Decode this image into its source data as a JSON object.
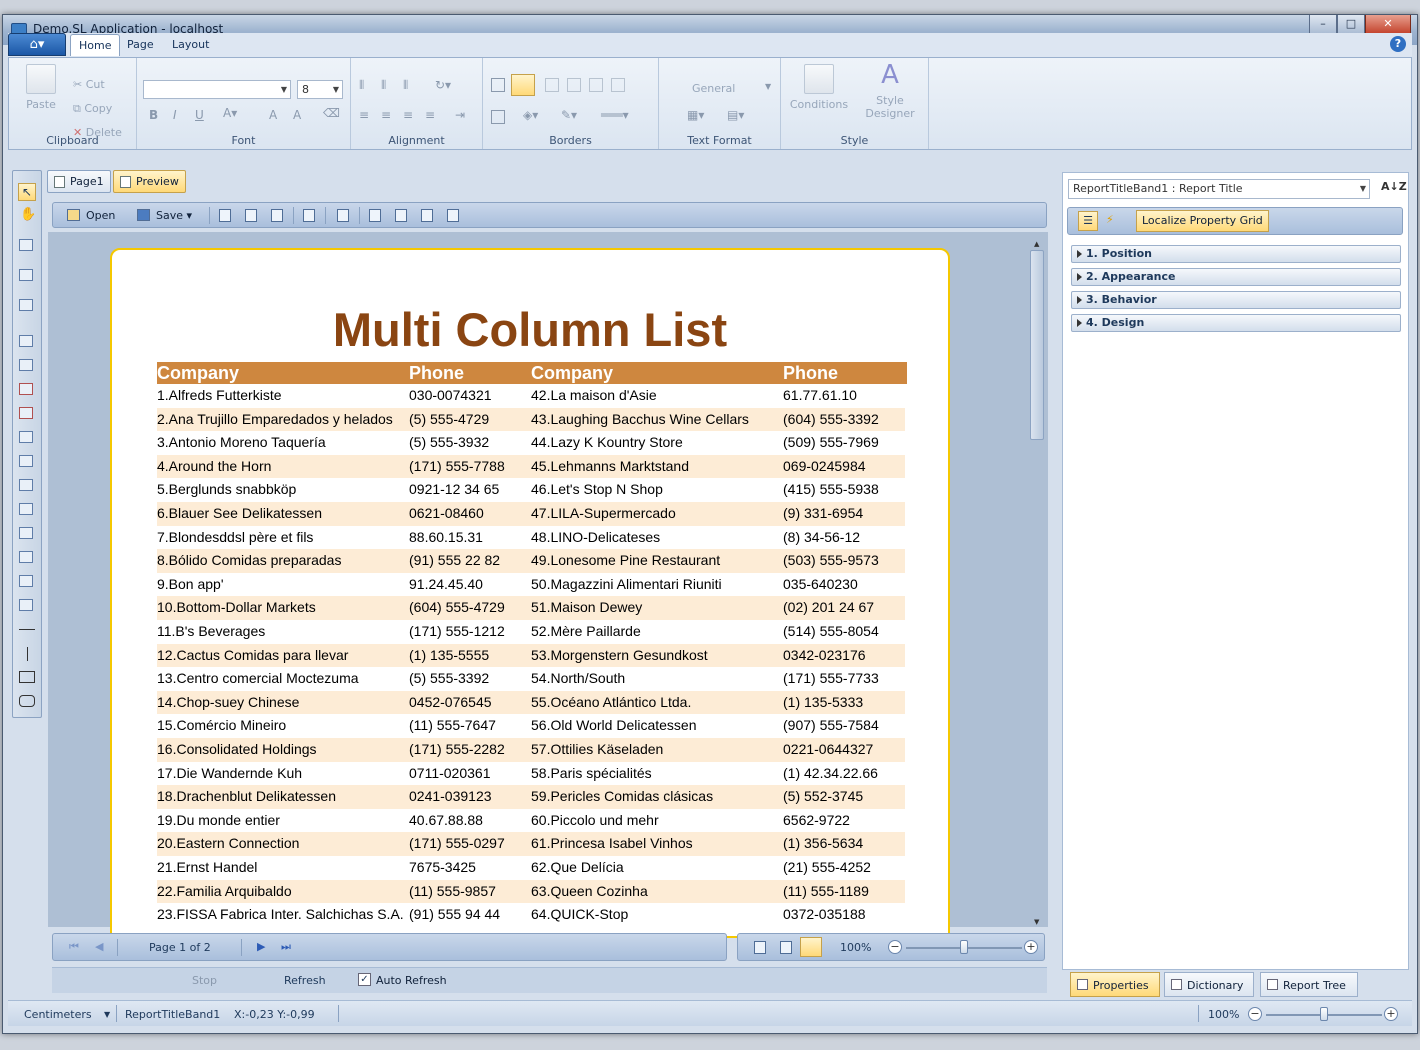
{
  "window": {
    "title": "Demo.SL Application - localhost",
    "minimize": "–",
    "maximize": "□",
    "close": "✕"
  },
  "ribbon": {
    "tabs": [
      "Home",
      "Page",
      "Layout"
    ],
    "active_tab": "Home",
    "help": "?",
    "clipboard": {
      "label": "Clipboard",
      "paste": "Paste",
      "cut": "Cut",
      "copy": "Copy",
      "delete": "Delete"
    },
    "font": {
      "label": "Font",
      "family": "",
      "size": "8"
    },
    "alignment": {
      "label": "Alignment"
    },
    "borders": {
      "label": "Borders"
    },
    "text_format": {
      "label": "Text Format",
      "format": "General"
    },
    "style": {
      "label": "Style",
      "conditions": "Conditions",
      "style_designer_1": "Style",
      "style_designer_2": "Designer"
    }
  },
  "doc_tabs": [
    "Page1",
    "Preview"
  ],
  "preview_toolbar": {
    "open": "Open",
    "save": "Save"
  },
  "report": {
    "title": "Multi Column List",
    "headers": [
      "Company",
      "Phone",
      "Company",
      "Phone"
    ],
    "rows": [
      [
        "1.Alfreds Futterkiste",
        "030-0074321",
        "42.La maison d'Asie",
        "61.77.61.10"
      ],
      [
        "2.Ana Trujillo Emparedados y helados",
        "(5) 555-4729",
        "43.Laughing Bacchus Wine Cellars",
        "(604) 555-3392"
      ],
      [
        "3.Antonio Moreno Taquería",
        "(5) 555-3932",
        "44.Lazy K Kountry Store",
        "(509) 555-7969"
      ],
      [
        "4.Around the Horn",
        "(171) 555-7788",
        "45.Lehmanns Marktstand",
        "069-0245984"
      ],
      [
        "5.Berglunds snabbköp",
        "0921-12 34 65",
        "46.Let's Stop N Shop",
        "(415) 555-5938"
      ],
      [
        "6.Blauer See Delikatessen",
        "0621-08460",
        "47.LILA-Supermercado",
        "(9) 331-6954"
      ],
      [
        "7.Blondesddsl père et fils",
        "88.60.15.31",
        "48.LINO-Delicateses",
        "(8) 34-56-12"
      ],
      [
        "8.Bólido Comidas preparadas",
        "(91) 555 22 82",
        "49.Lonesome Pine Restaurant",
        "(503) 555-9573"
      ],
      [
        "9.Bon app'",
        "91.24.45.40",
        "50.Magazzini Alimentari Riuniti",
        "035-640230"
      ],
      [
        "10.Bottom-Dollar Markets",
        "(604) 555-4729",
        "51.Maison Dewey",
        "(02) 201 24 67"
      ],
      [
        "11.B's Beverages",
        "(171) 555-1212",
        "52.Mère Paillarde",
        "(514) 555-8054"
      ],
      [
        "12.Cactus Comidas para llevar",
        "(1) 135-5555",
        "53.Morgenstern Gesundkost",
        "0342-023176"
      ],
      [
        "13.Centro comercial Moctezuma",
        "(5) 555-3392",
        "54.North/South",
        "(171) 555-7733"
      ],
      [
        "14.Chop-suey Chinese",
        "0452-076545",
        "55.Océano Atlántico Ltda.",
        "(1) 135-5333"
      ],
      [
        "15.Comércio Mineiro",
        "(11) 555-7647",
        "56.Old World Delicatessen",
        "(907) 555-7584"
      ],
      [
        "16.Consolidated Holdings",
        "(171) 555-2282",
        "57.Ottilies Käseladen",
        "0221-0644327"
      ],
      [
        "17.Die Wandernde Kuh",
        "0711-020361",
        "58.Paris spécialités",
        "(1) 42.34.22.66"
      ],
      [
        "18.Drachenblut Delikatessen",
        "0241-039123",
        "59.Pericles Comidas clásicas",
        "(5) 552-3745"
      ],
      [
        "19.Du monde entier",
        "40.67.88.88",
        "60.Piccolo und mehr",
        "6562-9722"
      ],
      [
        "20.Eastern Connection",
        "(171) 555-0297",
        "61.Princesa Isabel Vinhos",
        "(1) 356-5634"
      ],
      [
        "21.Ernst Handel",
        "7675-3425",
        "62.Que Delícia",
        "(21) 555-4252"
      ],
      [
        "22.Familia Arquibaldo",
        "(11) 555-9857",
        "63.Queen Cozinha",
        "(11) 555-1189"
      ],
      [
        "23.FISSA Fabrica Inter. Salchichas S.A.",
        "(91) 555 94 44",
        "64.QUICK-Stop",
        "0372-035188"
      ]
    ]
  },
  "navigation": {
    "page_info": "Page 1 of 2",
    "zoom": "100%",
    "zoom_level": 0.5
  },
  "preview_status": {
    "stop": "Stop",
    "refresh": "Refresh",
    "auto_refresh": "Auto Refresh",
    "auto_refresh_checked": "✓"
  },
  "properties_panel": {
    "component": "ReportTitleBand1 : Report Title",
    "localize_button": "Localize Property Grid",
    "sort_icon": "A↓Z",
    "sections": [
      "1. Position",
      "2. Appearance",
      "3. Behavior",
      "4. Design"
    ]
  },
  "bottom_tabs": [
    "Properties",
    "Dictionary",
    "Report Tree"
  ],
  "statusbar": {
    "units": "Centimeters",
    "component": "ReportTitleBand1",
    "coords": "X:-0,23  Y:-0,99",
    "zoom": "100%",
    "zoom_level": 0.5
  }
}
